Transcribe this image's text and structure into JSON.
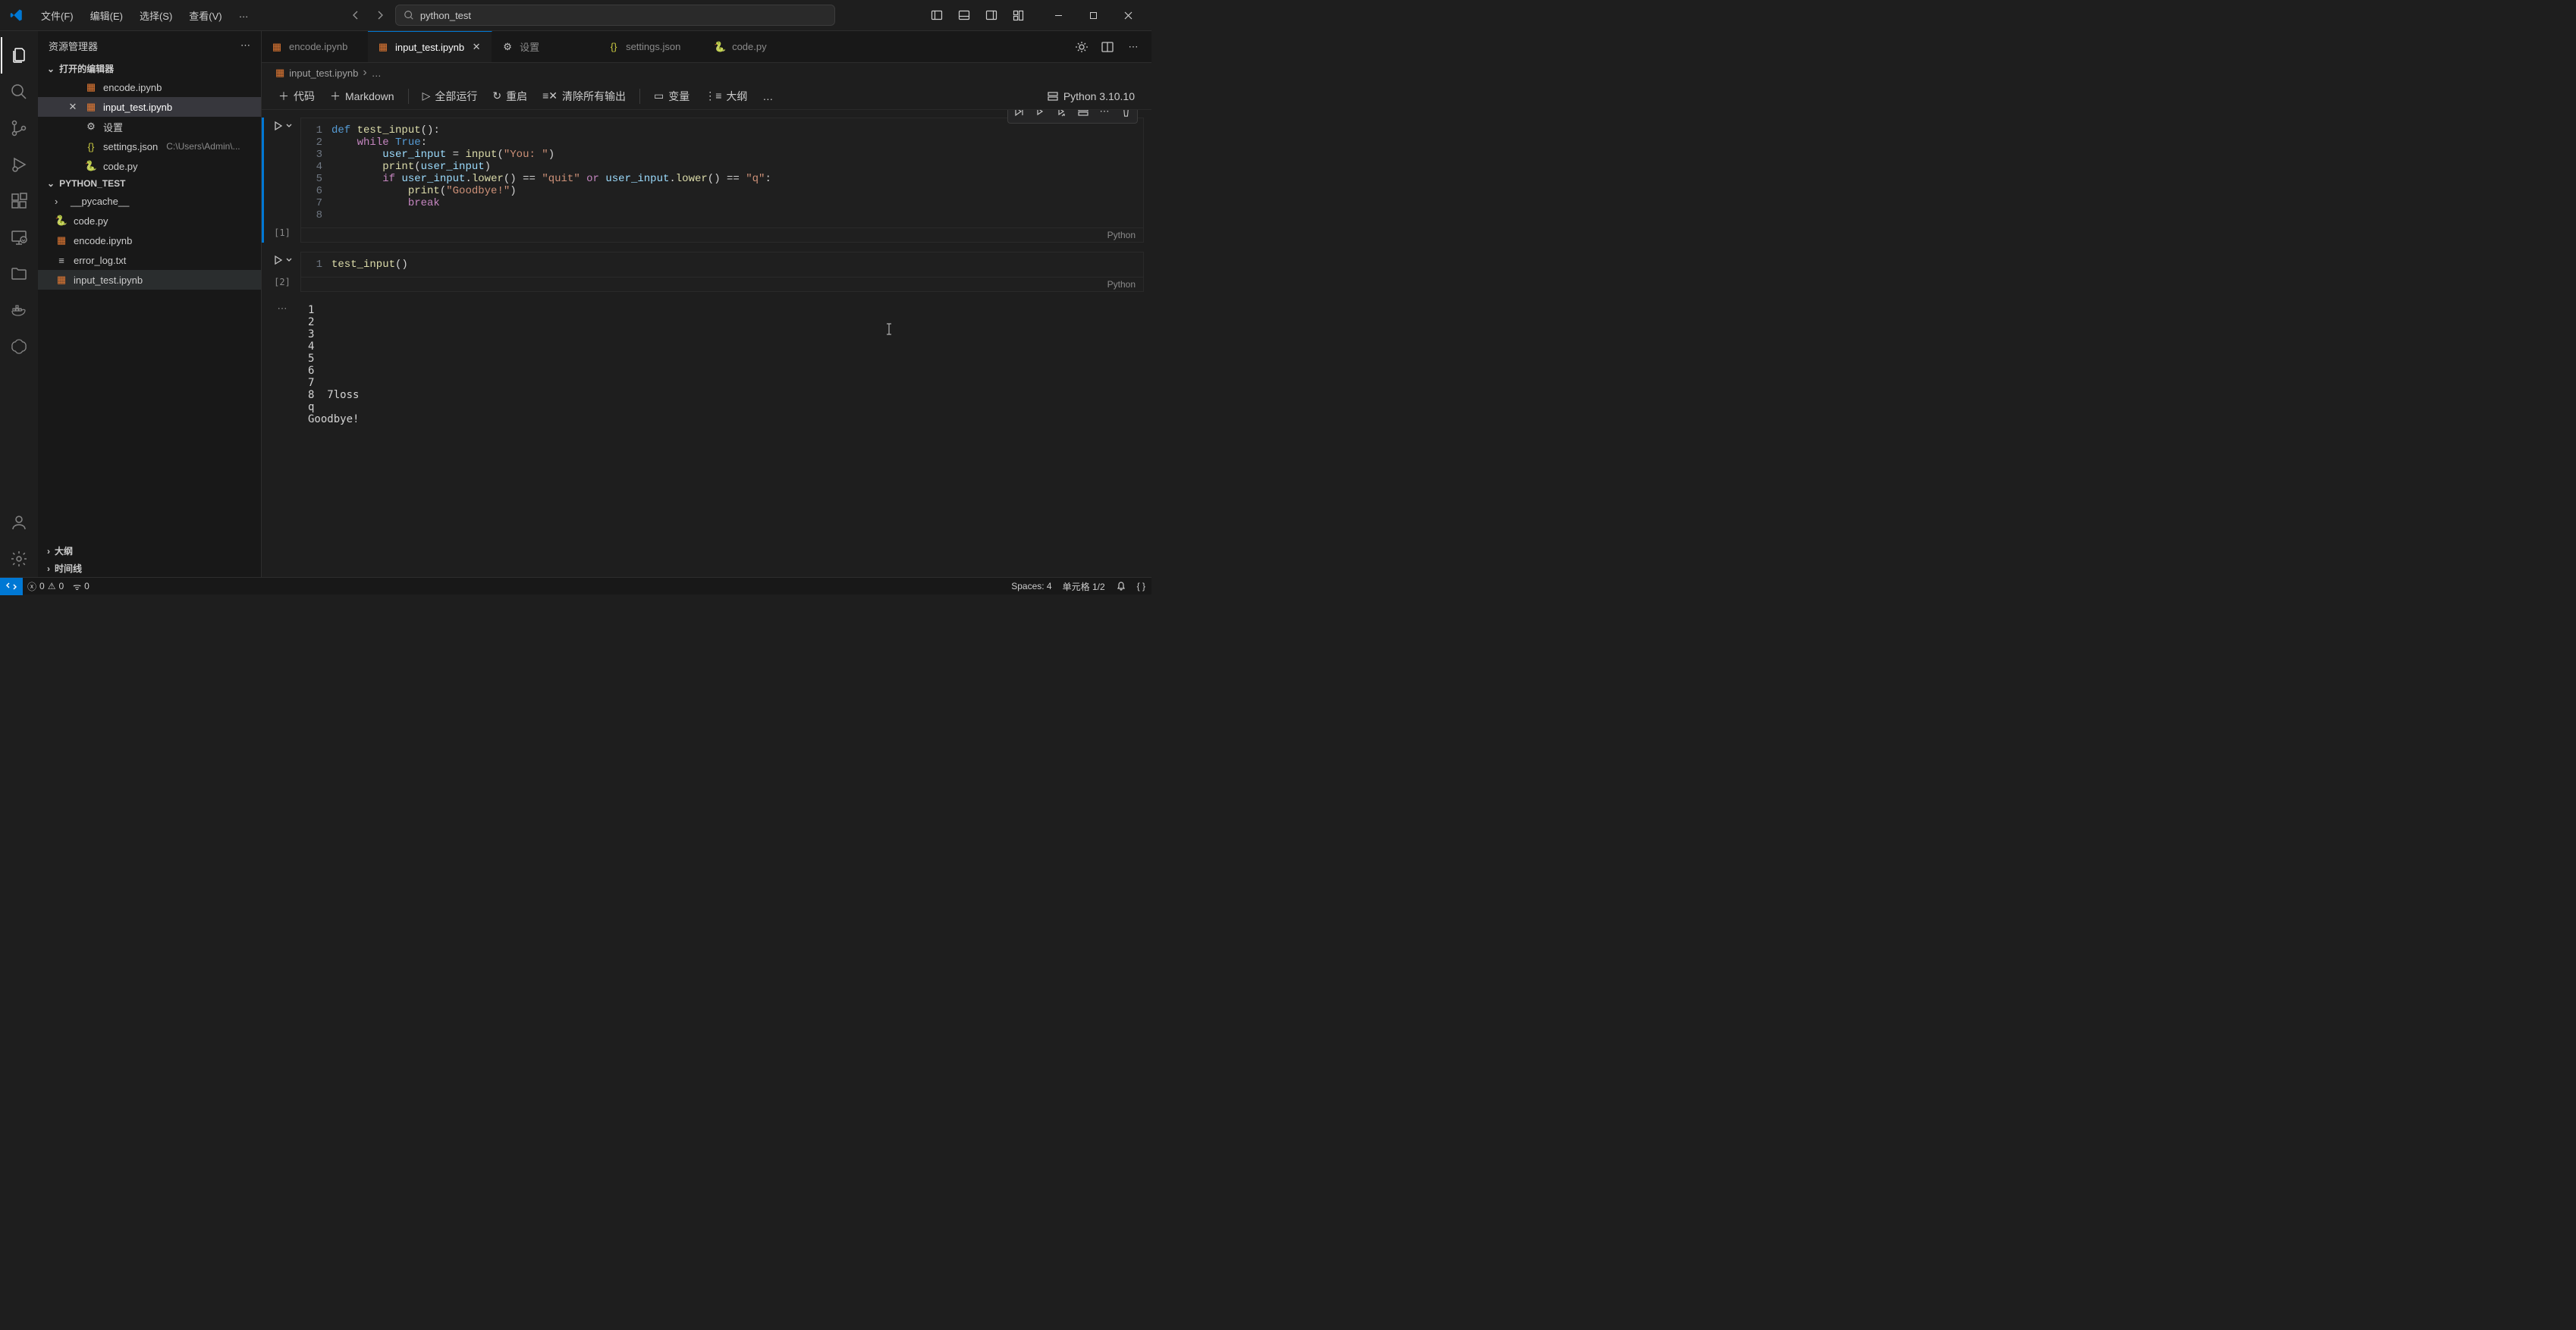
{
  "titlebar": {
    "menus": {
      "file": "文件(F)",
      "edit": "编辑(E)",
      "select": "选择(S)",
      "view": "查看(V)",
      "more": "…"
    },
    "search_text": "python_test"
  },
  "sidebar": {
    "title": "资源管理器",
    "open_editors_label": "打开的编辑器",
    "open_editors": [
      {
        "name": "encode.ipynb",
        "icon": "notebook"
      },
      {
        "name": "input_test.ipynb",
        "icon": "notebook",
        "active": true
      },
      {
        "name": "设置",
        "icon": "settings"
      },
      {
        "name": "settings.json",
        "icon": "json",
        "hint": "C:\\Users\\Admin\\..."
      },
      {
        "name": "code.py",
        "icon": "python"
      }
    ],
    "folder_root": "PYTHON_TEST",
    "files": [
      {
        "name": "__pycache__",
        "icon": "folder",
        "expandable": true
      },
      {
        "name": "code.py",
        "icon": "python"
      },
      {
        "name": "encode.ipynb",
        "icon": "notebook"
      },
      {
        "name": "error_log.txt",
        "icon": "txt"
      },
      {
        "name": "input_test.ipynb",
        "icon": "notebook",
        "selected": true
      }
    ],
    "outline_label": "大纲",
    "timeline_label": "时间线"
  },
  "tabs": [
    {
      "label": "encode.ipynb",
      "icon": "notebook"
    },
    {
      "label": "input_test.ipynb",
      "icon": "notebook",
      "active": true,
      "closeable": true
    },
    {
      "label": "设置",
      "icon": "settings"
    },
    {
      "label": "settings.json",
      "icon": "json"
    },
    {
      "label": "code.py",
      "icon": "python"
    }
  ],
  "breadcrumb": {
    "file": "input_test.ipynb",
    "rest": "…"
  },
  "nb_toolbar": {
    "code": "代码",
    "markdown": "Markdown",
    "run_all": "全部运行",
    "restart": "重启",
    "clear": "清除所有输出",
    "variables": "变量",
    "outline": "大纲",
    "more": "…",
    "kernel": "Python 3.10.10"
  },
  "cells": [
    {
      "exec": "[1]",
      "lang": "Python",
      "lines": [
        "def test_input():",
        "    while True:",
        "        user_input = input(\"You: \")",
        "        print(user_input)",
        "        if user_input.lower() == \"quit\" or user_input.lower() == \"q\":",
        "            print(\"Goodbye!\")",
        "            break",
        ""
      ]
    },
    {
      "exec": "[2]",
      "lang": "Python",
      "lines": [
        "test_input()"
      ]
    }
  ],
  "output_lines": [
    "1",
    "2",
    "3",
    "4",
    "5",
    "6",
    "7",
    "8  7loss",
    "q",
    "Goodbye!"
  ],
  "statusbar": {
    "errors": "0",
    "warnings": "0",
    "ports": "0",
    "spaces": "Spaces: 4",
    "cell": "单元格 1/2"
  }
}
